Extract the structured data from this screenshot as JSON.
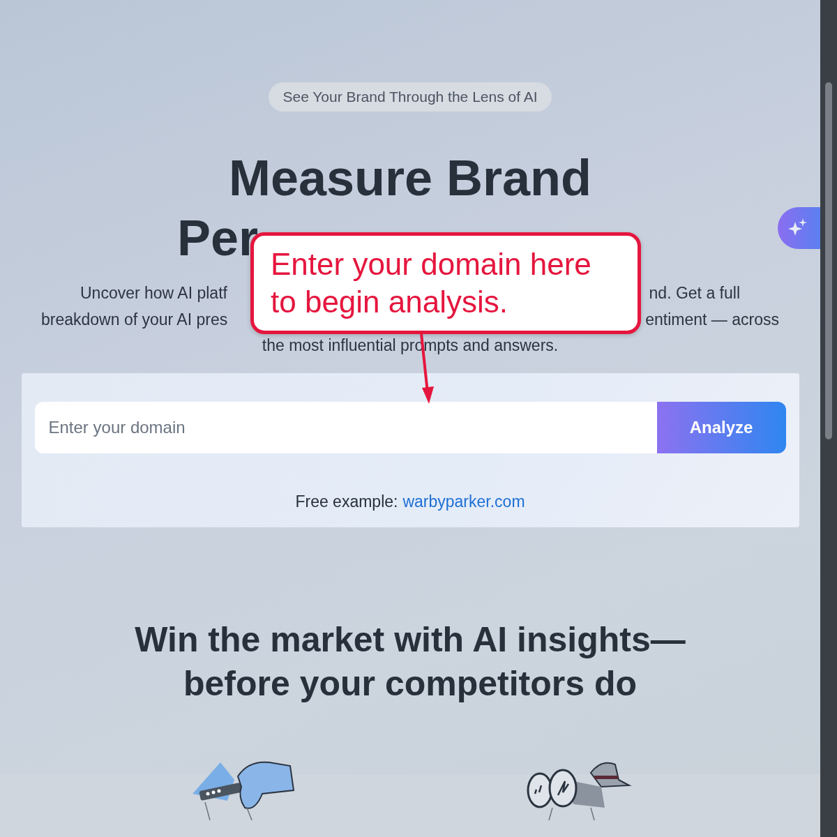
{
  "badge": "See Your Brand Through the Lens of AI",
  "hero": {
    "title_line": "Measure Brand",
    "title_fragment": "Per"
  },
  "description_lines": [
    [
      "Uncover how AI platf",
      "nd. Get a full"
    ],
    [
      "breakdown of your AI pres",
      "entiment — across"
    ],
    [
      "the most influential prompts and answers."
    ]
  ],
  "callout": "Enter your domain here to begin analysis.",
  "form": {
    "placeholder": "Enter your domain",
    "button": "Analyze",
    "example_label": "Free example:",
    "example_link": "warbyparker.com"
  },
  "section_title_lines": [
    "Win the market with AI insights—",
    "before your competitors do"
  ],
  "illustrations": [
    {
      "kind": "hand"
    },
    {
      "kind": "binoculars"
    }
  ]
}
